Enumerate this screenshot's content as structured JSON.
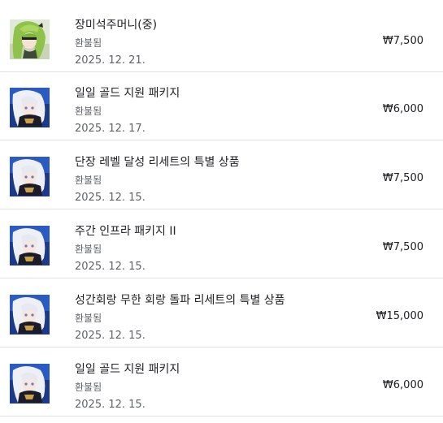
{
  "purchases": [
    {
      "title": "장미석주머니(중)",
      "status": "환불됨",
      "date": "2025. 12. 21.",
      "price": "₩7,500",
      "icon": "green-haired-character-thumbnail"
    },
    {
      "title": "일일 골드 지원 패키지",
      "status": "환불됨",
      "date": "2025. 12. 17.",
      "price": "₩6,000",
      "icon": "white-haired-character-thumbnail"
    },
    {
      "title": "단장 레벨 달성 리세트의 특별 상품",
      "status": "환불됨",
      "date": "2025. 12. 15.",
      "price": "₩7,500",
      "icon": "white-haired-character-thumbnail"
    },
    {
      "title": "주간 인프라 패키지 II",
      "status": "환불됨",
      "date": "2025. 12. 15.",
      "price": "₩7,500",
      "icon": "white-haired-character-thumbnail"
    },
    {
      "title": "성간회랑 무한 회랑 돌파 리세트의 특별 상품",
      "status": "환불됨",
      "date": "2025. 12. 15.",
      "price": "₩15,000",
      "icon": "white-haired-character-thumbnail"
    },
    {
      "title": "일일 골드 지원 패키지",
      "status": "환불됨",
      "date": "2025. 12. 15.",
      "price": "₩6,000",
      "icon": "white-haired-character-thumbnail"
    }
  ]
}
